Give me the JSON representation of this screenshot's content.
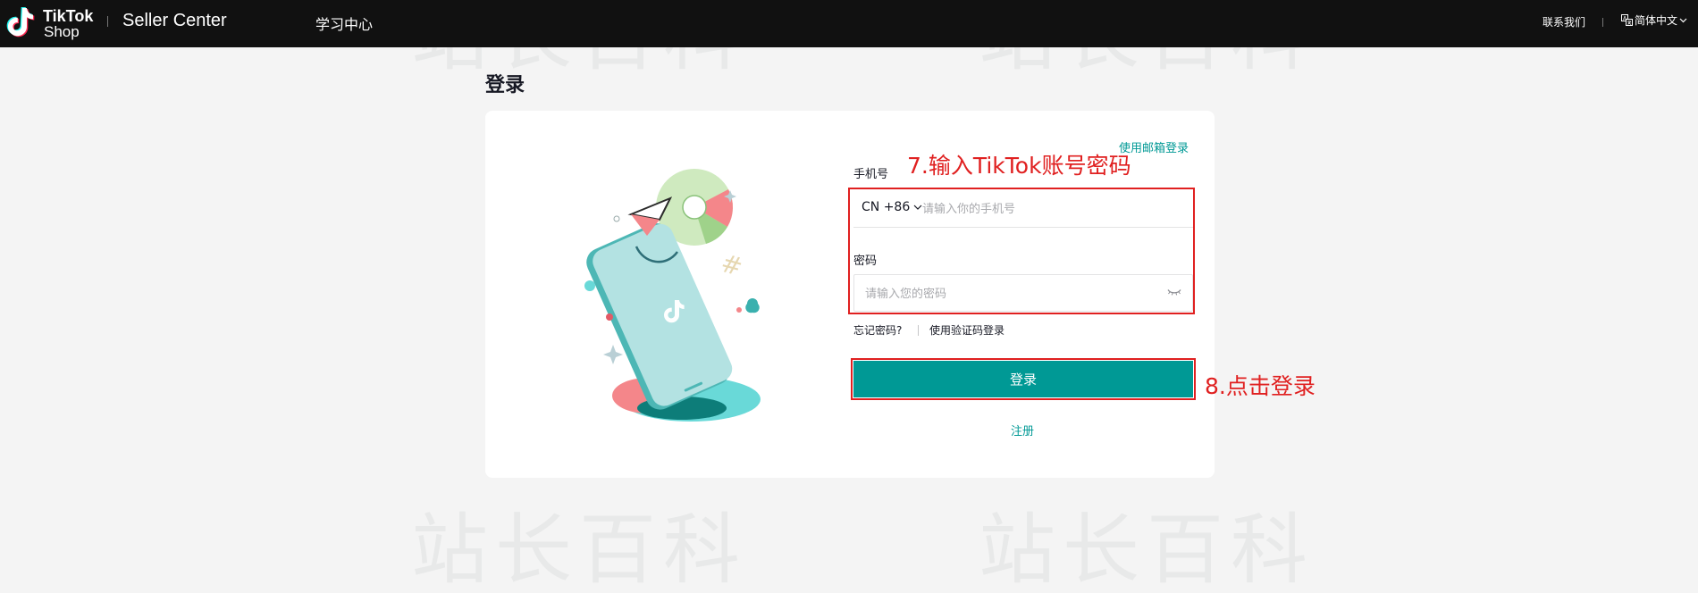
{
  "header": {
    "logo_line1": "TikTok",
    "logo_line2": "Shop",
    "product_name": "Seller Center",
    "nav_learn": "学习中心",
    "contact": "联系我们",
    "language": "简体中文"
  },
  "page": {
    "title": "登录"
  },
  "login_form": {
    "switch_email_link": "使用邮箱登录",
    "phone_label": "手机号",
    "country_code": "CN +86",
    "phone_placeholder": "请输入你的手机号",
    "password_label": "密码",
    "password_placeholder": "请输入您的密码",
    "forgot_password": "忘记密码?",
    "code_login": "使用验证码登录",
    "submit_label": "登录",
    "register": "注册"
  },
  "annotations": {
    "step7": "7.输入TikTok账号密码",
    "step8": "8.点击登录"
  },
  "watermark": "站长百科",
  "colors": {
    "accent": "#009995",
    "header_bg": "#111111",
    "annotation_red": "#e02020"
  },
  "icons": [
    "tiktok-logo-icon",
    "translate-icon",
    "chevron-down-icon",
    "eye-closed-icon"
  ]
}
